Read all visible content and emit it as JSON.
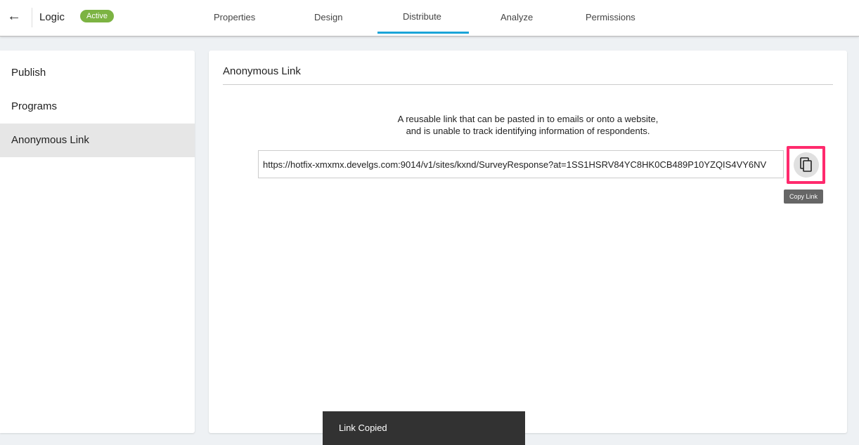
{
  "header": {
    "title": "Logic",
    "status": "Active",
    "tabs": [
      {
        "label": "Properties"
      },
      {
        "label": "Design"
      },
      {
        "label": "Distribute",
        "active": true
      },
      {
        "label": "Analyze"
      },
      {
        "label": "Permissions"
      }
    ],
    "accent": "#1ba4d8",
    "status_color": "#7cb342"
  },
  "sidebar": {
    "items": [
      {
        "label": "Publish"
      },
      {
        "label": "Programs"
      },
      {
        "label": "Anonymous Link",
        "selected": true
      }
    ]
  },
  "main": {
    "heading": "Anonymous Link",
    "description_line1": "A reusable link that can be pasted in to emails or onto a website,",
    "description_line2": "and is unable to track identifying information of respondents.",
    "link_value": "https://hotfix-xmxmx.develgs.com:9014/v1/sites/kxnd/SurveyResponse?at=1SS1HSRV84YC8HK0CB489P10YZQIS4VY6NV",
    "copy_icon": "copy-icon",
    "copy_tooltip": "Copy Link",
    "highlight_color": "#ff2a6d"
  },
  "toast": {
    "message": "Link Copied"
  }
}
